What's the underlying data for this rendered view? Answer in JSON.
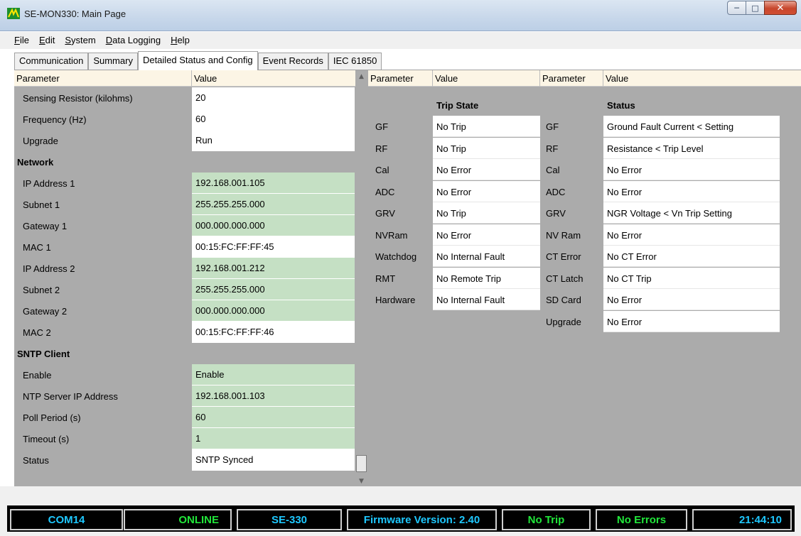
{
  "window": {
    "title": "SE-MON330: Main Page"
  },
  "menu": [
    "File",
    "Edit",
    "System",
    "Data Logging",
    "Help"
  ],
  "tabs": [
    "Communication",
    "Summary",
    "Detailed Status and Config",
    "Event Records",
    "IEC 61850"
  ],
  "left_table": {
    "headers": [
      "Parameter",
      "Value"
    ],
    "rows": [
      {
        "param": "Sensing Resistor (kilohms)",
        "value": "20",
        "style": "white"
      },
      {
        "param": "Frequency (Hz)",
        "value": "60",
        "style": "white"
      },
      {
        "param": "Upgrade",
        "value": "Run",
        "style": "white"
      },
      {
        "param": "Network",
        "value": "",
        "style": "section"
      },
      {
        "param": "IP Address 1",
        "value": "192.168.001.105",
        "style": "green"
      },
      {
        "param": "Subnet 1",
        "value": "255.255.255.000",
        "style": "green"
      },
      {
        "param": "Gateway 1",
        "value": "000.000.000.000",
        "style": "green"
      },
      {
        "param": "MAC 1",
        "value": "00:15:FC:FF:FF:45",
        "style": "white"
      },
      {
        "param": "IP Address 2",
        "value": "192.168.001.212",
        "style": "green"
      },
      {
        "param": "Subnet 2",
        "value": "255.255.255.000",
        "style": "green"
      },
      {
        "param": "Gateway 2",
        "value": "000.000.000.000",
        "style": "green"
      },
      {
        "param": "MAC 2",
        "value": "00:15:FC:FF:FF:46",
        "style": "white"
      },
      {
        "param": "SNTP Client",
        "value": "",
        "style": "section"
      },
      {
        "param": "Enable",
        "value": "Enable",
        "style": "green"
      },
      {
        "param": "NTP Server IP Address",
        "value": "192.168.001.103",
        "style": "green"
      },
      {
        "param": "Poll Period (s)",
        "value": "60",
        "style": "green"
      },
      {
        "param": "Timeout (s)",
        "value": "1",
        "style": "green"
      },
      {
        "param": "Status",
        "value": "SNTP Synced",
        "style": "white"
      }
    ]
  },
  "trip_table": {
    "headers": [
      "Parameter",
      "Value"
    ],
    "heading": "Trip State",
    "rows": [
      {
        "param": "GF",
        "value": "No Trip"
      },
      {
        "param": "RF",
        "value": "No Trip"
      },
      {
        "param": "Cal",
        "value": "No Error"
      },
      {
        "param": "ADC",
        "value": "No Error"
      },
      {
        "param": "GRV",
        "value": "No Trip"
      },
      {
        "param": "NVRam",
        "value": "No Error"
      },
      {
        "param": "Watchdog",
        "value": "No Internal Fault"
      },
      {
        "param": "RMT",
        "value": "No Remote Trip"
      },
      {
        "param": "Hardware",
        "value": "No Internal Fault"
      }
    ]
  },
  "status_table": {
    "headers": [
      "Parameter",
      "Value"
    ],
    "heading": "Status",
    "rows": [
      {
        "param": "GF",
        "value": "Ground Fault Current < Setting"
      },
      {
        "param": "RF",
        "value": "Resistance < Trip Level"
      },
      {
        "param": "Cal",
        "value": "No Error"
      },
      {
        "param": "ADC",
        "value": "No Error"
      },
      {
        "param": "GRV",
        "value": "NGR Voltage < Vn Trip Setting"
      },
      {
        "param": "NV Ram",
        "value": "No Error"
      },
      {
        "param": "CT Error",
        "value": "No CT Error"
      },
      {
        "param": "CT Latch",
        "value": "No CT Trip"
      },
      {
        "param": "SD Card",
        "value": "No Error"
      },
      {
        "param": "Upgrade",
        "value": "No Error"
      }
    ]
  },
  "statusbar": {
    "port": "COM14",
    "connection": "ONLINE",
    "device": "SE-330",
    "firmware": "Firmware Version: 2.40",
    "trip": "No Trip",
    "errors": "No Errors",
    "time": "21:44:10"
  }
}
